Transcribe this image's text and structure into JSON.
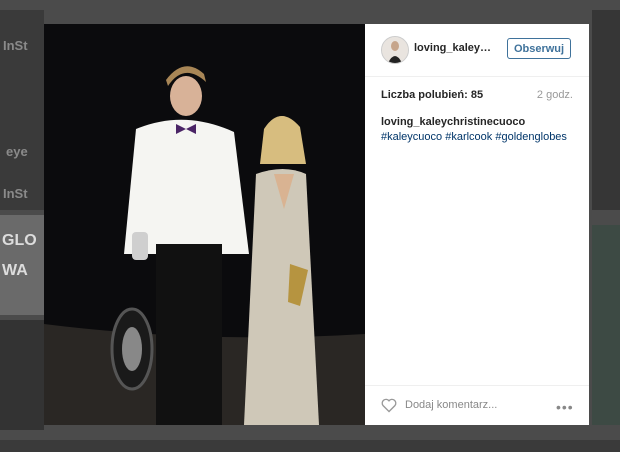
{
  "background": {
    "logos": [
      "InSt",
      "InSt",
      "eye",
      "GLO",
      "WA"
    ]
  },
  "post": {
    "username": "loving_kaleychristinecuoco",
    "follow_label": "Obserwuj",
    "likes_text": "Liczba polubień: 85",
    "time_text": "2 godz.",
    "caption_user": "loving_kaleychristinecuoco",
    "hashtags": [
      "#kaleycuoco",
      "#karlcook",
      "#goldenglobes"
    ],
    "comment_placeholder": "Dodaj komentarz...",
    "more_label": "•••"
  },
  "colors": {
    "link": "#003569",
    "button": "#3f729b"
  }
}
